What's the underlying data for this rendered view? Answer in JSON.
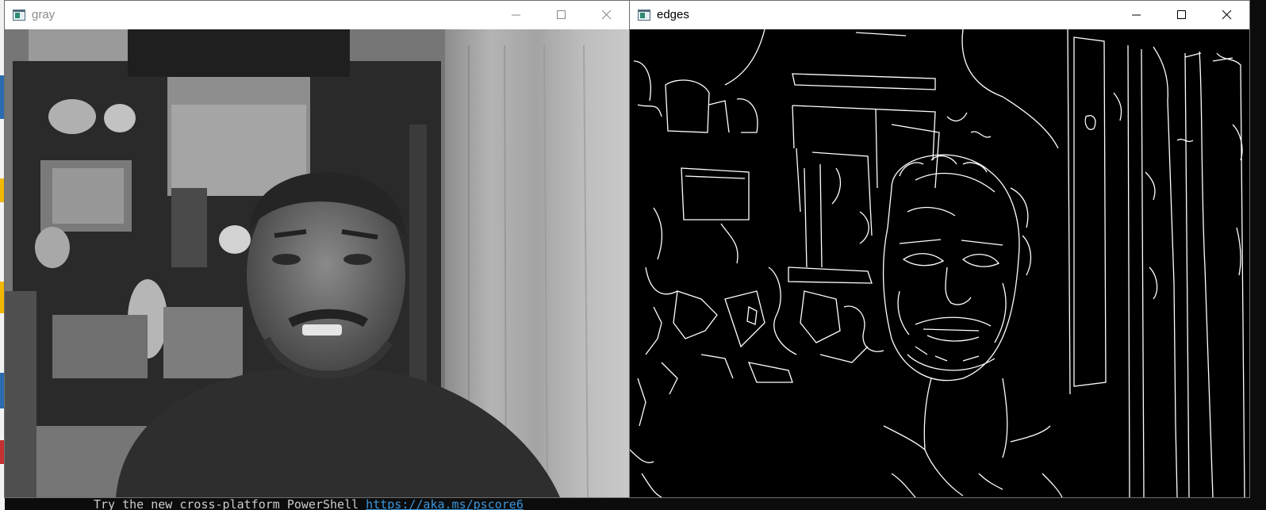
{
  "console": {
    "line_prefix": "Try the new cross-platform PowerShell ",
    "line_link": "https://aka.ms/pscore6"
  },
  "windows": [
    {
      "title": "gray",
      "icon": "opencv-window-icon",
      "controls": [
        "minimize-icon",
        "maximize-icon",
        "close-icon"
      ],
      "content": "grayscale camera frame"
    },
    {
      "title": "edges",
      "icon": "opencv-window-icon",
      "controls": [
        "minimize-icon",
        "maximize-icon",
        "close-icon"
      ],
      "content": "canny edge map"
    }
  ],
  "colors": {
    "titlebar": "#ffffff",
    "inactive_title": "#8a8a8a",
    "active_title": "#000000",
    "edge_stroke": "#ffffff",
    "edge_background": "#000000"
  }
}
